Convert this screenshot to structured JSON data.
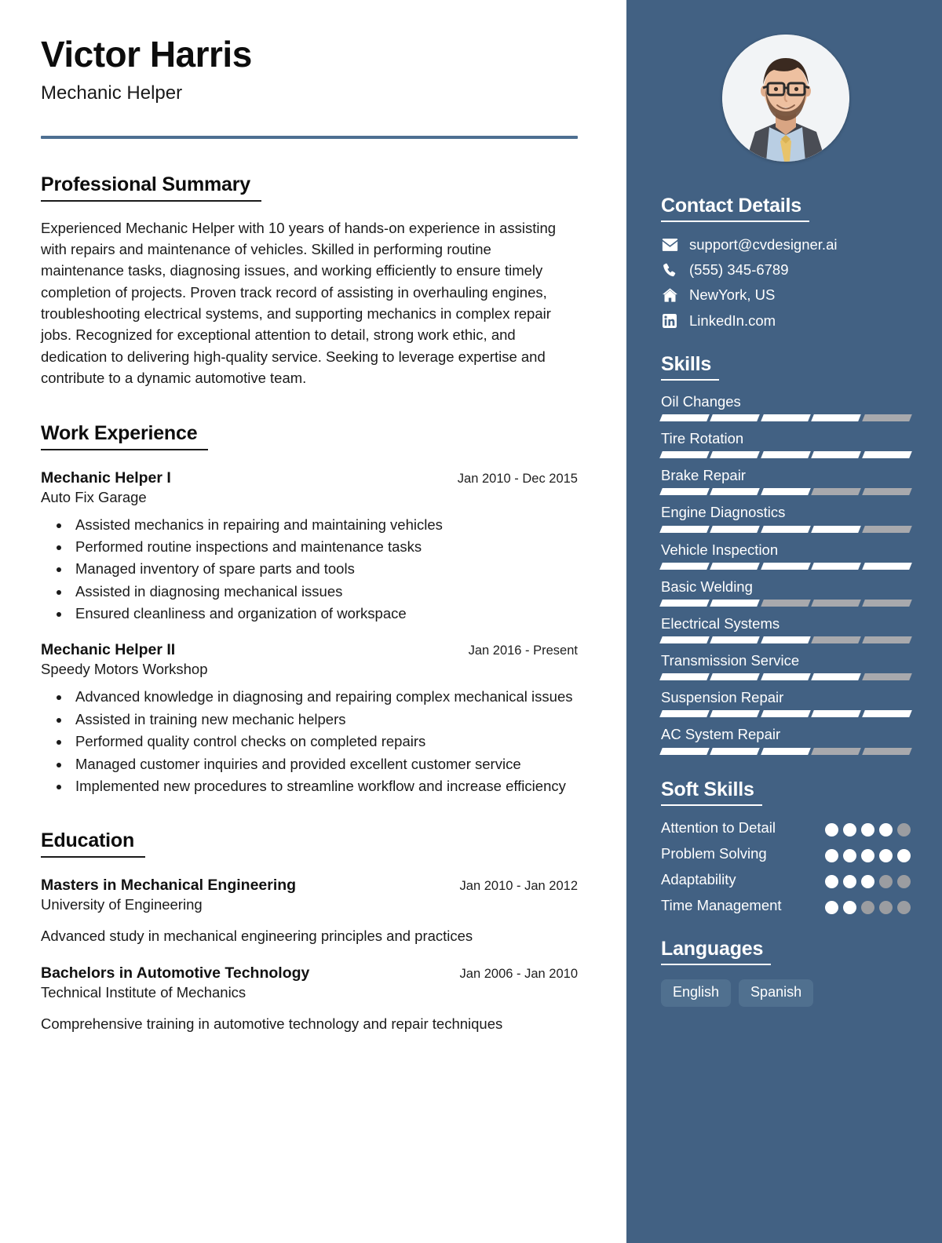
{
  "theme": {
    "sidebar_bg": "#426183",
    "rule_color": "#4d6f92",
    "accent_white": "#ffffff",
    "bar_off": "#a8a9ad",
    "pill_bg": "#50708f"
  },
  "header": {
    "name": "Victor Harris",
    "role": "Mechanic Helper"
  },
  "summary": {
    "heading": "Professional Summary",
    "text": "Experienced Mechanic Helper with 10 years of hands-on experience in assisting with repairs and maintenance of vehicles. Skilled in performing routine maintenance tasks, diagnosing issues, and working efficiently to ensure timely completion of projects. Proven track record of assisting in overhauling engines, troubleshooting electrical systems, and supporting mechanics in complex repair jobs. Recognized for exceptional attention to detail, strong work ethic, and dedication to delivering high-quality service. Seeking to leverage expertise and contribute to a dynamic automotive team."
  },
  "work": {
    "heading": "Work Experience",
    "entries": [
      {
        "title": "Mechanic Helper I",
        "org": "Auto Fix Garage",
        "date": "Jan 2010 - Dec 2015",
        "bullets": [
          "Assisted mechanics in repairing and maintaining vehicles",
          "Performed routine inspections and maintenance tasks",
          "Managed inventory of spare parts and tools",
          "Assisted in diagnosing mechanical issues",
          "Ensured cleanliness and organization of workspace"
        ]
      },
      {
        "title": "Mechanic Helper II",
        "org": "Speedy Motors Workshop",
        "date": "Jan 2016 - Present",
        "bullets": [
          "Advanced knowledge in diagnosing and repairing complex mechanical issues",
          "Assisted in training new mechanic helpers",
          "Performed quality control checks on completed repairs",
          "Managed customer inquiries and provided excellent customer service",
          "Implemented new procedures to streamline workflow and increase efficiency"
        ]
      }
    ]
  },
  "education": {
    "heading": "Education",
    "entries": [
      {
        "title": "Masters in Mechanical Engineering",
        "org": "University of Engineering",
        "date": "Jan 2010 - Jan 2012",
        "desc": "Advanced study in mechanical engineering principles and practices"
      },
      {
        "title": "Bachelors in Automotive Technology",
        "org": "Technical Institute of Mechanics",
        "date": "Jan 2006 - Jan 2010",
        "desc": "Comprehensive training in automotive technology and repair techniques"
      }
    ]
  },
  "sidebar": {
    "contact": {
      "heading": "Contact Details",
      "items": [
        {
          "icon": "envelope-icon",
          "text": "support@cvdesigner.ai"
        },
        {
          "icon": "phone-icon",
          "text": "(555) 345-6789"
        },
        {
          "icon": "home-icon",
          "text": "NewYork, US"
        },
        {
          "icon": "linkedin-icon",
          "text": "LinkedIn.com"
        }
      ]
    },
    "skills": {
      "heading": "Skills",
      "max": 5,
      "items": [
        {
          "name": "Oil Changes",
          "level": 4
        },
        {
          "name": "Tire Rotation",
          "level": 5
        },
        {
          "name": "Brake Repair",
          "level": 3
        },
        {
          "name": "Engine Diagnostics",
          "level": 4
        },
        {
          "name": "Vehicle Inspection",
          "level": 5
        },
        {
          "name": "Basic Welding",
          "level": 2
        },
        {
          "name": "Electrical Systems",
          "level": 3
        },
        {
          "name": "Transmission Service",
          "level": 4
        },
        {
          "name": "Suspension Repair",
          "level": 5
        },
        {
          "name": "AC System Repair",
          "level": 3
        }
      ]
    },
    "soft_skills": {
      "heading": "Soft Skills",
      "max": 5,
      "items": [
        {
          "name": "Attention to Detail",
          "level": 4
        },
        {
          "name": "Problem Solving",
          "level": 5
        },
        {
          "name": "Adaptability",
          "level": 3
        },
        {
          "name": "Time Management",
          "level": 2
        }
      ]
    },
    "languages": {
      "heading": "Languages",
      "items": [
        "English",
        "Spanish"
      ]
    }
  }
}
